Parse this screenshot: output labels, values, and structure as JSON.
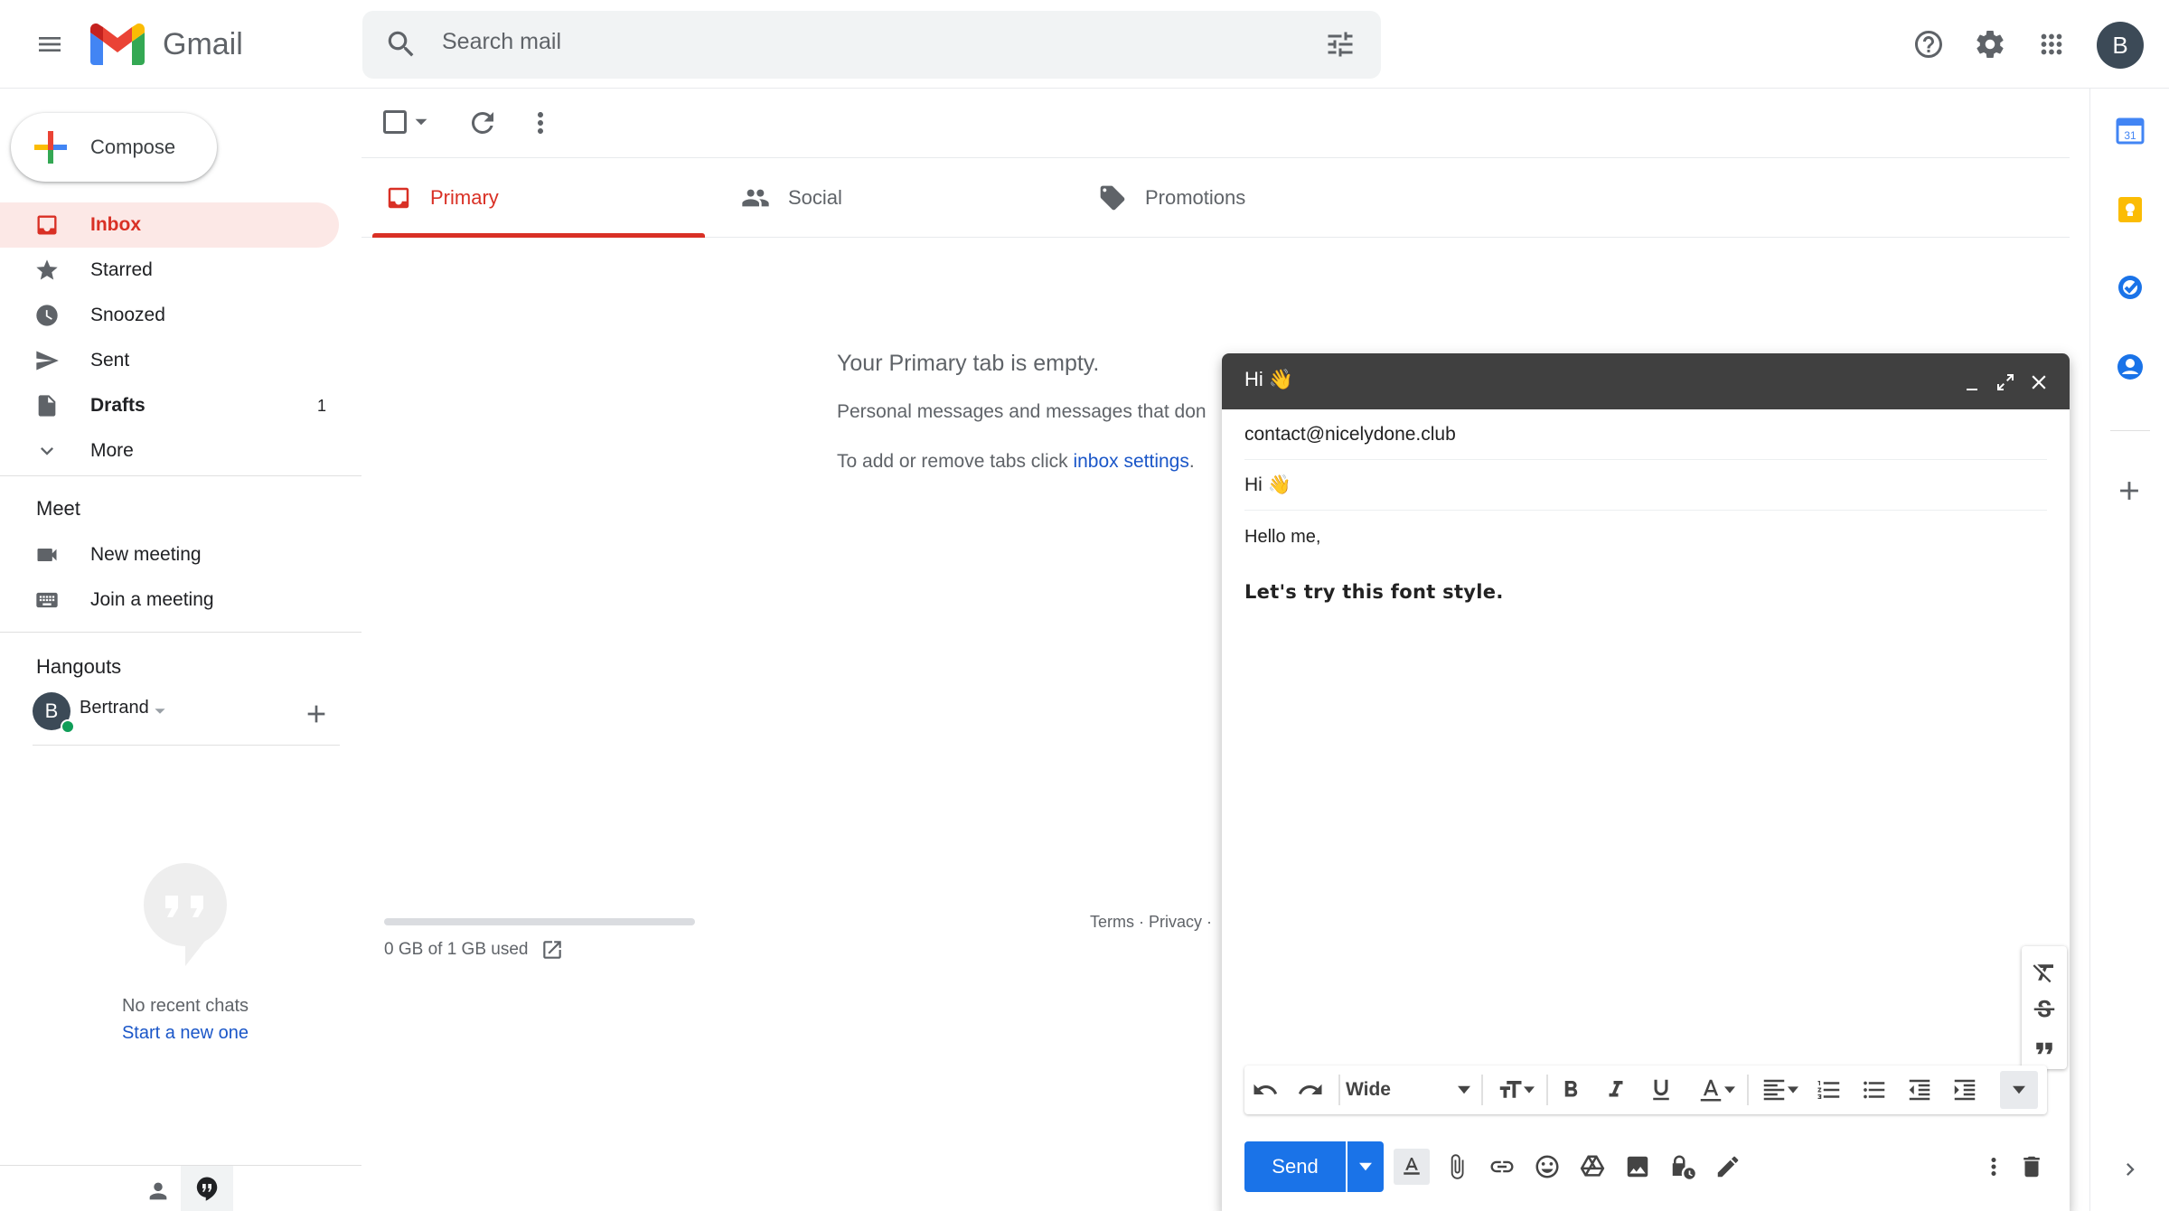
{
  "app": {
    "name": "Gmail",
    "user_initial": "B"
  },
  "search": {
    "placeholder": "Search mail"
  },
  "compose_label": "Compose",
  "nav": {
    "items": [
      {
        "label": "Inbox",
        "count": ""
      },
      {
        "label": "Starred",
        "count": ""
      },
      {
        "label": "Snoozed",
        "count": ""
      },
      {
        "label": "Sent",
        "count": ""
      },
      {
        "label": "Drafts",
        "count": "1"
      },
      {
        "label": "More",
        "count": ""
      }
    ]
  },
  "meet": {
    "title": "Meet",
    "new_meeting": "New meeting",
    "join": "Join a meeting"
  },
  "hangouts": {
    "title": "Hangouts",
    "user": "Bertrand",
    "user_initial": "B",
    "no_chats": "No recent chats",
    "start_new": "Start a new one"
  },
  "tabs": [
    {
      "label": "Primary"
    },
    {
      "label": "Social"
    },
    {
      "label": "Promotions"
    }
  ],
  "empty": {
    "title": "Your Primary tab is empty.",
    "line1": "Personal messages and messages that don",
    "line2_prefix": "To add or remove tabs click ",
    "line2_link": "inbox settings",
    "line2_suffix": "."
  },
  "footer": {
    "storage": "0 GB of 1 GB used",
    "storage_fraction": 0,
    "links": "Terms · Privacy ·"
  },
  "compose_window": {
    "title": "Hi 👋",
    "to": "contact@nicelydone.club",
    "subject": "Hi 👋",
    "body_line1": "Hello me,",
    "body_line2": "Let's try this font style.",
    "font": "Wide",
    "send_label": "Send"
  },
  "colors": {
    "accent_red": "#d93025",
    "send_blue": "#1a73e8",
    "compose_header": "#404040",
    "active_bg": "#fce8e6"
  }
}
